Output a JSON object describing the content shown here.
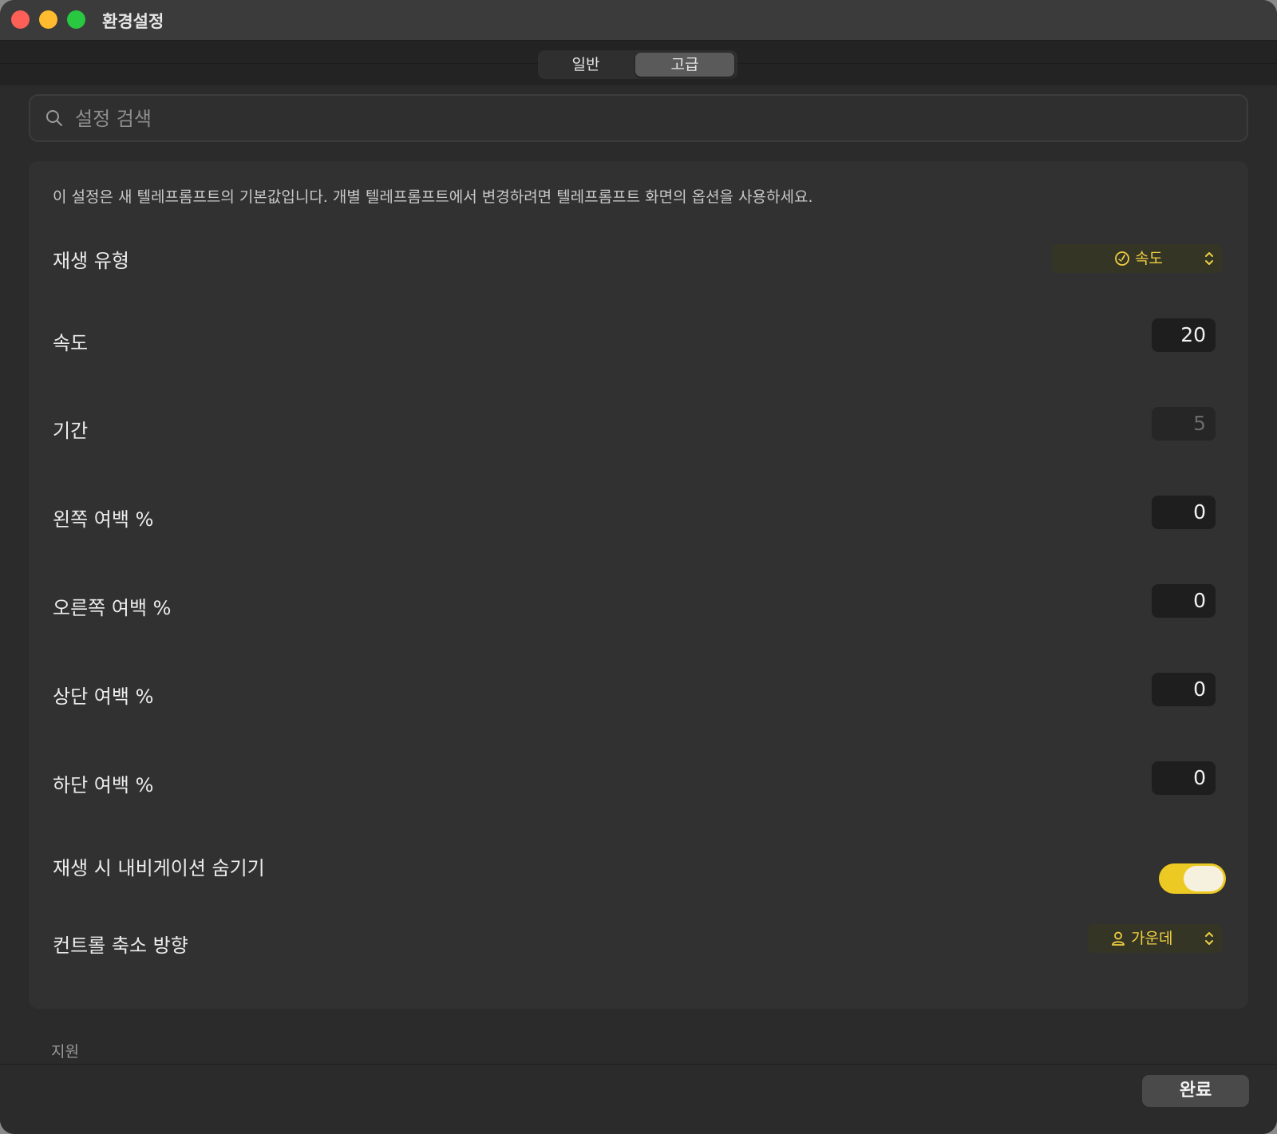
{
  "window": {
    "title": "환경설정"
  },
  "tabs": [
    {
      "label": "일반",
      "selected": false
    },
    {
      "label": "고급",
      "selected": true
    }
  ],
  "search": {
    "placeholder": "설정 검색",
    "value": ""
  },
  "panel": {
    "description": "이 설정은 새 텔레프롬프트의 기본값입니다. 개별 텔레프롬프트에서 변경하려면 텔레프롬프트 화면의 옵션을 사용하세요.",
    "playback_type": {
      "label": "재생 유형",
      "value": "속도",
      "icon": "gauge-icon"
    },
    "speed": {
      "label": "속도",
      "value": "20"
    },
    "duration": {
      "label": "기간",
      "value": "5",
      "disabled": true
    },
    "left_margin": {
      "label": "왼쪽 여백 %",
      "value": "0"
    },
    "right_margin": {
      "label": "오른쪽 여백 %",
      "value": "0"
    },
    "top_margin": {
      "label": "상단 여백 %",
      "value": "0"
    },
    "bottom_margin": {
      "label": "하단 여백 %",
      "value": "0"
    },
    "hide_nav": {
      "label": "재생 시 내비게이션 숨기기",
      "on": true
    },
    "control_shrink": {
      "label": "컨트롤 축소 방향",
      "value": "가운데",
      "icon": "person-icon"
    }
  },
  "support_section": {
    "label": "지원"
  },
  "footer": {
    "done_label": "완료"
  },
  "colors": {
    "accent": "#ecc923",
    "window_bg": "#2b2b2b",
    "panel_bg": "#313131"
  }
}
